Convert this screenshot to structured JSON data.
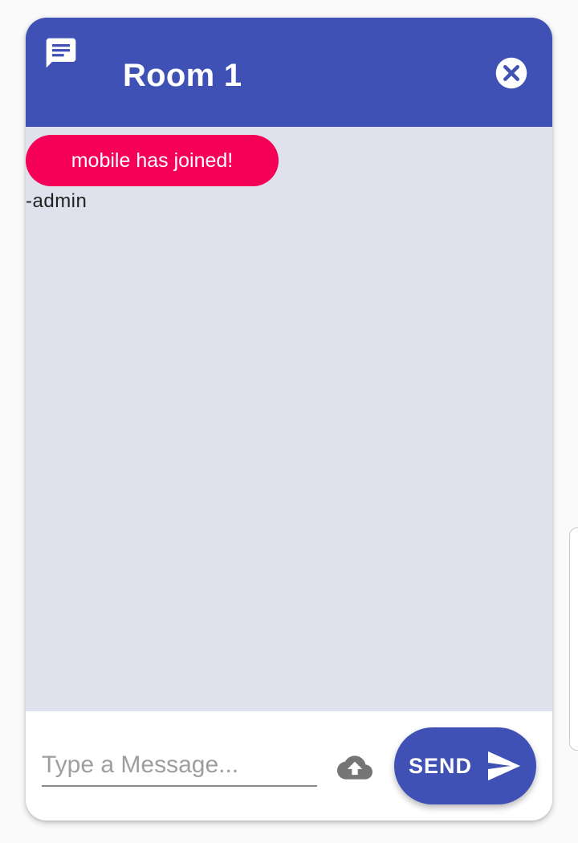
{
  "header": {
    "icon": "chat-bubble-icon",
    "room_name": "Room 1",
    "close_icon": "close-circle-icon",
    "color": "#3f51b5"
  },
  "messages": [
    {
      "text": "mobile has joined!",
      "author": "-admin",
      "bubble_color": "#f50057"
    }
  ],
  "composer": {
    "placeholder": "Type a Message...",
    "value": "",
    "upload_icon": "cloud-upload-icon",
    "send_label": "SEND",
    "send_icon": "send-icon"
  }
}
